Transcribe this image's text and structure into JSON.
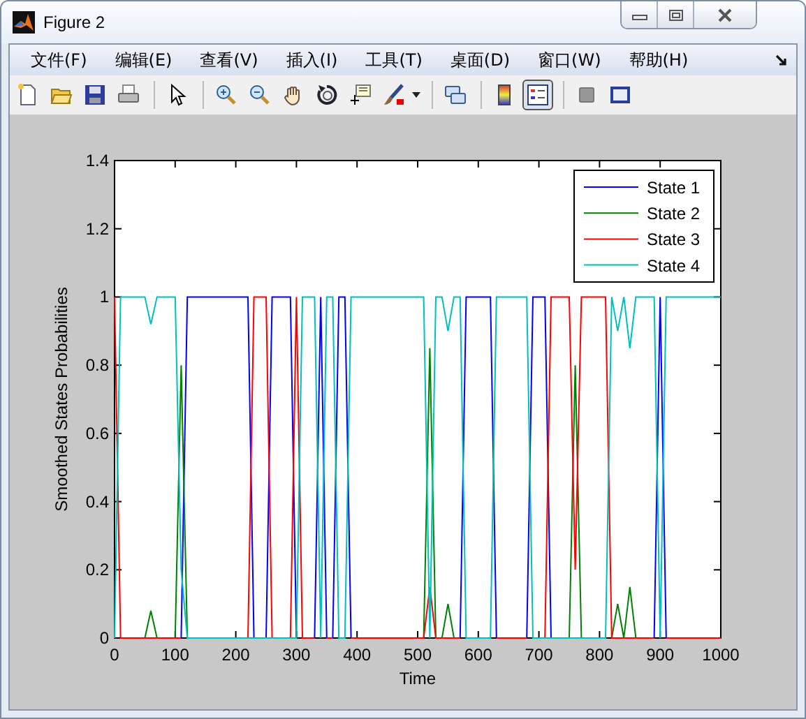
{
  "window": {
    "title": "Figure 2"
  },
  "menu": [
    {
      "label": "文件(F)"
    },
    {
      "label": "编辑(E)"
    },
    {
      "label": "查看(V)"
    },
    {
      "label": "插入(I)"
    },
    {
      "label": "工具(T)"
    },
    {
      "label": "桌面(D)"
    },
    {
      "label": "窗口(W)"
    },
    {
      "label": "帮助(H)"
    }
  ],
  "toolbar": {
    "colorbar_pressed": false,
    "legend_pressed": true
  },
  "axes": {
    "chart_data": {
      "type": "line",
      "legend": "upper right",
      "xlabel": "Time",
      "ylabel": "Smoothed States Probabilities",
      "xlim": [
        0,
        1000
      ],
      "ylim": [
        0,
        1.4
      ],
      "xticks": [
        0,
        100,
        200,
        300,
        400,
        500,
        600,
        700,
        800,
        900,
        1000
      ],
      "yticks": [
        0,
        0.2,
        0.4,
        0.6,
        0.8,
        1,
        1.2,
        1.4
      ],
      "x": [
        0,
        10,
        20,
        30,
        40,
        50,
        60,
        70,
        80,
        90,
        100,
        110,
        120,
        130,
        140,
        150,
        160,
        170,
        180,
        190,
        200,
        210,
        220,
        230,
        240,
        250,
        260,
        270,
        280,
        290,
        300,
        310,
        320,
        330,
        340,
        350,
        360,
        370,
        380,
        390,
        400,
        410,
        420,
        430,
        440,
        450,
        460,
        470,
        480,
        490,
        500,
        510,
        520,
        530,
        540,
        550,
        560,
        570,
        580,
        590,
        600,
        610,
        620,
        630,
        640,
        650,
        660,
        670,
        680,
        690,
        700,
        710,
        720,
        730,
        740,
        750,
        760,
        770,
        780,
        790,
        800,
        810,
        820,
        830,
        840,
        850,
        860,
        870,
        880,
        890,
        900,
        910,
        920,
        930,
        940,
        950,
        960,
        970,
        980,
        990,
        1000
      ],
      "series": [
        {
          "name": "State 1",
          "color": "#0000ff",
          "values": [
            null,
            null,
            null,
            null,
            null,
            null,
            null,
            null,
            null,
            null,
            null,
            0,
            1,
            1,
            1,
            1,
            1,
            1,
            1,
            1,
            1,
            1,
            1,
            0,
            null,
            0,
            1,
            1,
            1,
            1,
            0,
            null,
            null,
            0,
            1,
            0,
            0,
            1,
            1,
            0,
            null,
            null,
            null,
            null,
            null,
            null,
            null,
            null,
            null,
            null,
            null,
            null,
            null,
            null,
            null,
            null,
            null,
            0,
            1,
            1,
            1,
            1,
            1,
            0,
            null,
            null,
            null,
            null,
            0,
            1,
            1,
            1,
            0,
            null,
            null,
            null,
            null,
            null,
            null,
            null,
            null,
            null,
            null,
            null,
            null,
            null,
            null,
            null,
            null,
            0,
            1,
            0,
            null,
            null,
            null,
            null,
            null,
            null,
            null,
            null,
            null
          ]
        },
        {
          "name": "State 2",
          "color": "#008000",
          "values": [
            null,
            null,
            null,
            null,
            null,
            0,
            0.08,
            0,
            null,
            null,
            0,
            0.8,
            0,
            null,
            null,
            null,
            null,
            null,
            null,
            null,
            null,
            null,
            null,
            null,
            null,
            null,
            null,
            null,
            null,
            null,
            null,
            null,
            null,
            null,
            null,
            null,
            null,
            null,
            null,
            null,
            null,
            null,
            null,
            null,
            null,
            null,
            null,
            null,
            null,
            null,
            null,
            0,
            0.85,
            0,
            0,
            0.1,
            0,
            null,
            null,
            null,
            null,
            null,
            null,
            null,
            null,
            null,
            null,
            null,
            null,
            null,
            null,
            null,
            null,
            null,
            null,
            0,
            0.8,
            0,
            null,
            null,
            null,
            null,
            0,
            0.1,
            0,
            0.15,
            0,
            null,
            null,
            null,
            null,
            null,
            null,
            null,
            null,
            null,
            null,
            null,
            null,
            null,
            null
          ]
        },
        {
          "name": "State 3",
          "color": "#ff0000",
          "values": [
            1,
            0,
            0,
            0,
            0,
            0,
            0,
            0,
            0,
            0,
            0,
            0,
            null,
            null,
            null,
            null,
            null,
            null,
            null,
            null,
            null,
            null,
            0,
            1,
            1,
            1,
            0,
            null,
            null,
            0,
            1,
            0,
            0,
            0,
            null,
            0,
            0,
            null,
            null,
            0,
            0,
            0,
            0,
            0,
            0,
            0,
            0,
            0,
            0,
            0,
            0,
            0,
            0.15,
            0,
            0,
            0,
            0,
            0,
            null,
            null,
            null,
            null,
            null,
            0,
            0,
            0,
            0,
            0,
            0,
            null,
            null,
            0,
            1,
            1,
            1,
            1,
            0.2,
            1,
            1,
            1,
            1,
            1,
            0,
            0,
            0,
            0,
            0,
            0,
            0,
            0,
            null,
            0,
            0,
            0,
            0,
            0,
            0,
            0,
            0,
            0,
            0
          ]
        },
        {
          "name": "State 4",
          "color": "#00bfbf",
          "values": [
            0,
            1,
            1,
            1,
            1,
            1,
            0.92,
            1,
            1,
            1,
            1,
            0.2,
            0,
            0,
            0,
            0,
            0,
            0,
            0,
            0,
            0,
            0,
            0,
            0,
            0,
            0,
            0,
            0,
            0,
            0,
            0,
            1,
            1,
            1,
            0,
            1,
            1,
            0,
            0,
            1,
            1,
            1,
            1,
            1,
            1,
            1,
            1,
            1,
            1,
            1,
            1,
            1,
            0,
            1,
            1,
            0.9,
            1,
            1,
            0,
            0,
            0,
            0,
            0,
            1,
            1,
            1,
            1,
            1,
            1,
            0,
            0,
            0,
            0,
            0,
            0,
            0,
            0,
            0,
            0,
            0,
            0,
            0,
            1,
            0.9,
            1,
            0.85,
            1,
            1,
            1,
            1,
            0,
            1,
            1,
            1,
            1,
            1,
            1,
            1,
            1,
            1,
            1
          ]
        }
      ]
    }
  }
}
